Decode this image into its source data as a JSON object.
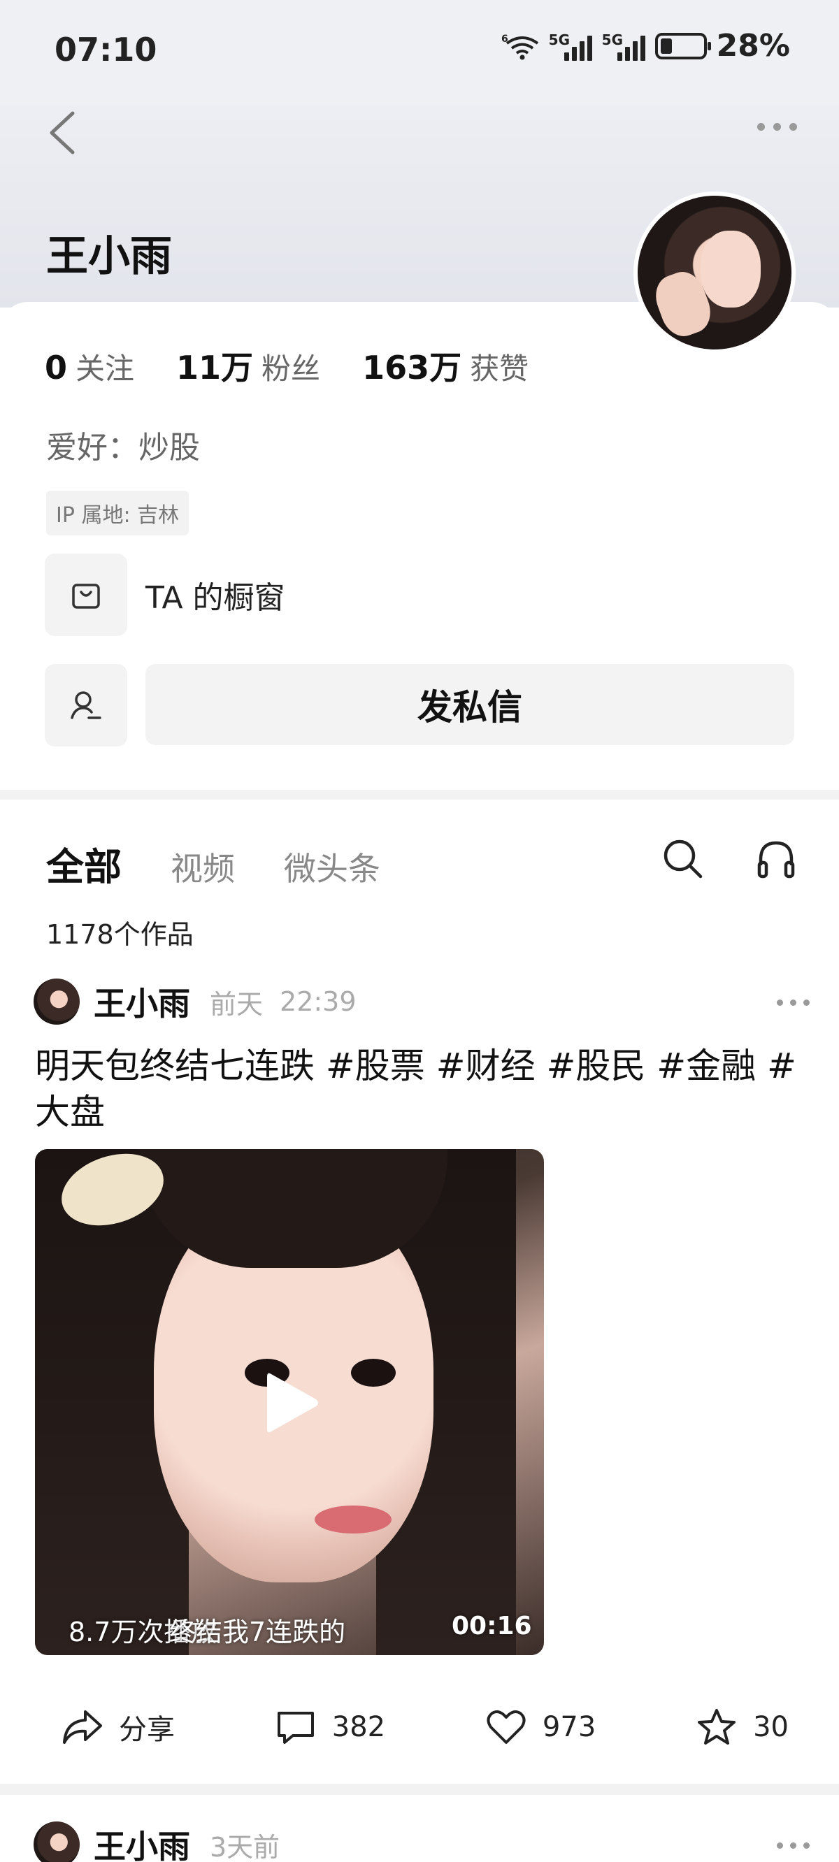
{
  "status_bar": {
    "time": "07:10",
    "battery": "28%",
    "battery_level": 0.28,
    "signal_tags": [
      "5G",
      "5G"
    ],
    "wifi_tag": "6"
  },
  "nav": {
    "back_icon": "chevron-left-icon",
    "more_icon": "more-horizontal-icon"
  },
  "profile": {
    "name": "王小雨",
    "stats": [
      {
        "value": "0",
        "label": "关注"
      },
      {
        "value": "11万",
        "label": "粉丝"
      },
      {
        "value": "163万",
        "label": "获赞"
      }
    ],
    "hobby": "爱好：炒股",
    "ip": "IP 属地: 吉林",
    "shop_label": "TA 的橱窗",
    "message_button": "发私信"
  },
  "tabs": {
    "items": [
      "全部",
      "视频",
      "微头条"
    ],
    "active": 0,
    "works_count": "1178个作品"
  },
  "post": {
    "author": "王小雨",
    "day": "前天",
    "time": "22:39",
    "text": "明天包终结七连跌 #股票 #财经 #股民 #金融 #大盘",
    "video": {
      "views": "8.7万次播放",
      "caption": "终结我7连跌的",
      "duration": "00:16"
    },
    "actions": {
      "share": "分享",
      "comments": "382",
      "likes": "973",
      "favorites": "30"
    }
  },
  "post2": {
    "author": "王小雨",
    "day": "3天前"
  }
}
